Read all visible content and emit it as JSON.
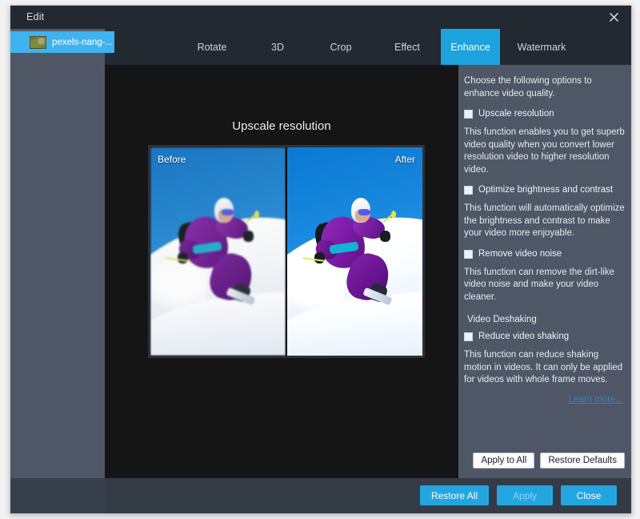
{
  "window": {
    "title": "Edit",
    "close_icon": "close-icon"
  },
  "sidebar": {
    "clips": [
      {
        "name": "pexels-nang-...",
        "thumb_icon": "video-thumbnail"
      }
    ]
  },
  "tabs": [
    {
      "label": "Rotate",
      "active": false
    },
    {
      "label": "3D",
      "active": false
    },
    {
      "label": "Crop",
      "active": false
    },
    {
      "label": "Effect",
      "active": false
    },
    {
      "label": "Enhance",
      "active": true
    },
    {
      "label": "Watermark",
      "active": false
    }
  ],
  "preview": {
    "title": "Upscale resolution",
    "before_label": "Before",
    "after_label": "After"
  },
  "options": {
    "intro": "Choose the following options to enhance video quality.",
    "items": [
      {
        "label": "Upscale resolution",
        "checked": false,
        "description": "This function enables you to get superb video quality when you convert lower resolution video to higher resolution video."
      },
      {
        "label": "Optimize brightness and contrast",
        "checked": false,
        "description": "This function will automatically optimize the brightness and contrast to make your video more enjoyable."
      },
      {
        "label": "Remove video noise",
        "checked": false,
        "description": "This function can remove the dirt-like video noise and make your video cleaner."
      }
    ],
    "group_label": "Video Deshaking",
    "deshake": {
      "label": "Reduce video shaking",
      "checked": false,
      "description": "This function can reduce shaking motion in videos. It can only be applied for videos with whole frame moves."
    },
    "learn_more": "Learn more...",
    "apply_to_all": "Apply to All",
    "restore_defaults": "Restore Defaults"
  },
  "footer": {
    "restore_all": "Restore All",
    "apply": "Apply",
    "close": "Close"
  },
  "colors": {
    "accent": "#1CA2DC",
    "panel": "#4f5767",
    "titlebar": "#232931",
    "stage": "#151515",
    "link": "#2f84c8",
    "footer_button": "#23A6E0"
  }
}
